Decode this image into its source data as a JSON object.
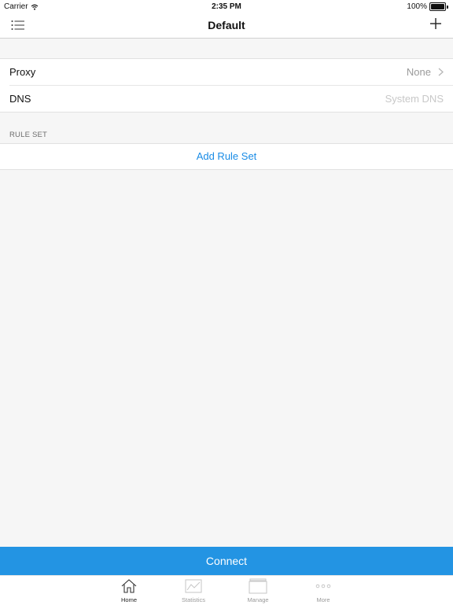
{
  "status_bar": {
    "carrier": "Carrier",
    "time": "2:35 PM",
    "battery": "100%",
    "wifi_icon": "wifi-icon",
    "battery_icon": "battery-icon"
  },
  "nav": {
    "title": "Default",
    "left_icon": "list-icon",
    "right_icon": "plus-icon"
  },
  "settings": [
    {
      "label": "Proxy",
      "value": "None",
      "icon": "chevron-right-icon"
    },
    {
      "label": "DNS",
      "value": "System DNS"
    }
  ],
  "rule_set": {
    "header": "RULE SET",
    "add_label": "Add Rule Set"
  },
  "connect_label": "Connect",
  "tabs": [
    {
      "label": "Home",
      "icon": "home-icon",
      "active": true
    },
    {
      "label": "Statistics",
      "icon": "chart-icon",
      "active": false
    },
    {
      "label": "Manage",
      "icon": "folder-icon",
      "active": false
    },
    {
      "label": "More",
      "icon": "more-dots-icon",
      "active": false
    }
  ],
  "colors": {
    "accent": "#2394e3",
    "link": "#1a8ce6",
    "background": "#f6f6f6"
  }
}
